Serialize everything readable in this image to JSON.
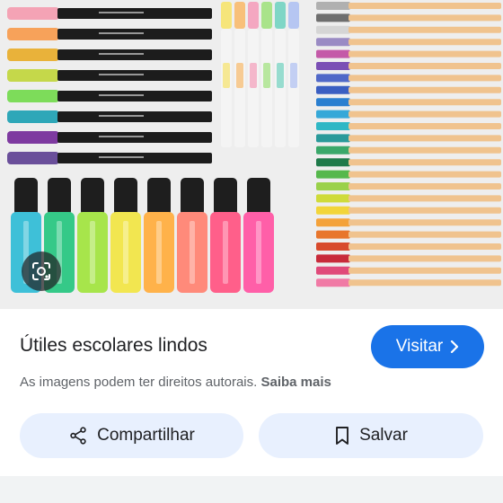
{
  "result": {
    "title": "Útiles escolares lindos",
    "visit_label": "Visitar",
    "rights_text": "As imagens podem ter direitos autorais.",
    "learn_more_label": "Saiba mais"
  },
  "actions": {
    "share_label": "Compartilhar",
    "save_label": "Salvar"
  },
  "image": {
    "marker_colors": [
      "#f4a3b5",
      "#f7a25a",
      "#e9b23a",
      "#c5d84a",
      "#7ddc5a",
      "#2ea7b8",
      "#7e3aa0",
      "#6a4f9a"
    ],
    "highlighter_colors": [
      "#3ec0d8",
      "#35c988",
      "#a7e54b",
      "#f2e650",
      "#ffb24a",
      "#ff8a7a",
      "#ff5f8a",
      "#ff5fa8"
    ],
    "pastel_colors": [
      "#f6e57a",
      "#f8c07a",
      "#f4a7c1",
      "#a9e38a",
      "#7fd6c6",
      "#b6c6f2"
    ],
    "fineliner_colors": [
      "#b0b0b0",
      "#6e6e6e",
      "#d5d5d5",
      "#9a8bc4",
      "#c45aa8",
      "#7a4fb5",
      "#5068c8",
      "#3a5ec2",
      "#2a7fd0",
      "#36a8d8",
      "#2fb7c5",
      "#2a9a9a",
      "#3aa86a",
      "#1f7a4a",
      "#56b84c",
      "#9ad14a",
      "#cfdb3a",
      "#f2d53a",
      "#f4a23a",
      "#e8762c",
      "#d84a2c",
      "#c82a3a",
      "#e04a7a",
      "#f07aa5"
    ]
  }
}
